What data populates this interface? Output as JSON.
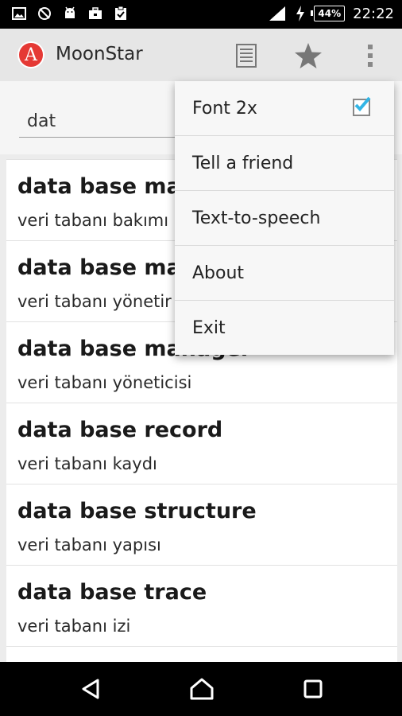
{
  "status_bar": {
    "battery": "44%",
    "time": "22:22",
    "left_icons": [
      "image-icon",
      "no-sync-icon",
      "android-icon",
      "briefcase-icon",
      "clipboard-check-icon"
    ],
    "right_icons": [
      "signal-icon",
      "charging-icon",
      "battery-icon"
    ]
  },
  "app": {
    "title": "MoonStar",
    "logo_letter": "A",
    "logo_color": "#e53935",
    "actions": [
      "list-icon",
      "star-icon",
      "overflow-icon"
    ]
  },
  "search": {
    "value": "dat"
  },
  "results": [
    {
      "term": "data base mai",
      "translation": "veri tabanı bakımı"
    },
    {
      "term": "data base mar",
      "translation": "veri tabanı yönetir"
    },
    {
      "term": "data base manager",
      "translation": "veri tabanı yöneticisi"
    },
    {
      "term": "data base record",
      "translation": "veri tabanı kaydı"
    },
    {
      "term": "data base structure",
      "translation": "veri tabanı yapısı"
    },
    {
      "term": "data base trace",
      "translation": "veri tabanı izi"
    }
  ],
  "menu": {
    "items": [
      {
        "label": "Font 2x",
        "checked": true
      },
      {
        "label": "Tell a friend"
      },
      {
        "label": "Text-to-speech"
      },
      {
        "label": "About"
      },
      {
        "label": "Exit"
      }
    ],
    "accent": "#33b5e5"
  },
  "nav": [
    "back-icon",
    "home-icon",
    "recents-icon"
  ]
}
